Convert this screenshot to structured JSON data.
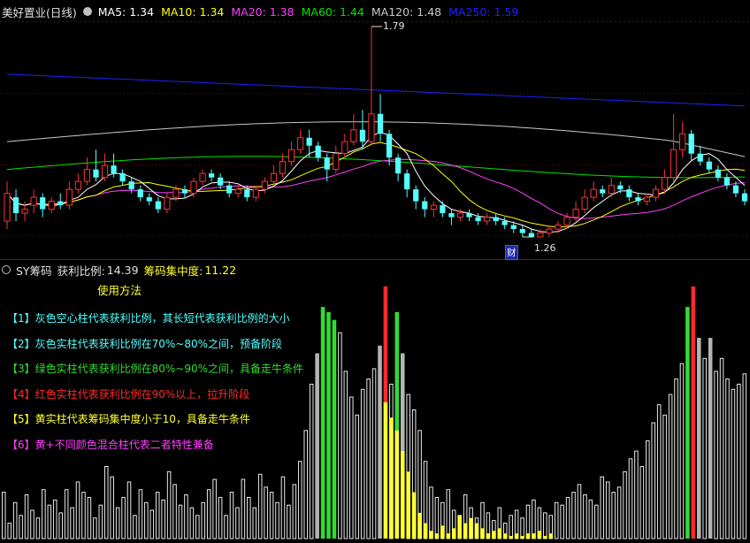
{
  "colors": {
    "up": "#ff3232",
    "down": "#54ffff",
    "ma5": "#ffffff",
    "ma10": "#ffff00",
    "ma20": "#ff40ff",
    "ma60": "#00e600",
    "ma120": "#c8c8c8",
    "ma250": "#2020ff",
    "hollow_gray": "#e8e8e8",
    "solid_gray": "#b4b4b4",
    "green": "#32dc32",
    "red": "#ff2a2a",
    "yellow": "#ffff32",
    "grid": "#7a0000"
  },
  "top_panel": {
    "title": "美好置业(日线)",
    "ma": [
      {
        "label": "MA5:",
        "value": "1.34",
        "color": "#ffffff"
      },
      {
        "label": "MA10:",
        "value": "1.34",
        "color": "#ffff00"
      },
      {
        "label": "MA20:",
        "value": "1.38",
        "color": "#ff40ff"
      },
      {
        "label": "MA60:",
        "value": "1.44",
        "color": "#00e600"
      },
      {
        "label": "MA120:",
        "value": "1.48",
        "color": "#c8c8c8"
      },
      {
        "label": "MA250:",
        "value": "1.59",
        "color": "#2020ff"
      }
    ],
    "high_label": "1.79",
    "low_label": "1.26",
    "cai_badge": "财"
  },
  "bottom_panel": {
    "indicator_name": "SY筹码",
    "profit_label": "获利比例:",
    "profit_value": "14.39",
    "conc_label": "筹码集中度:",
    "conc_value": "11.22",
    "usage_title": "使用方法",
    "legend": [
      {
        "text": "【1】灰色空心柱代表获利比例，其长短代表获利比例的大小",
        "color": "#54ffff"
      },
      {
        "text": "【2】灰色实柱代表获利比例在70%~80%之间，预备阶段",
        "color": "#54ffff"
      },
      {
        "text": "【3】绿色实柱代表获利比例在80%~90%之间，具备走牛条件",
        "color": "#32dc32"
      },
      {
        "text": "【4】红色实柱代表获利比例在90%以上，拉升阶段",
        "color": "#ff2a2a"
      },
      {
        "text": "【5】黄实柱代表筹码集中度小于10，具备走牛条件",
        "color": "#ffff32"
      },
      {
        "text": "【6】黄+不同颜色混合柱代表二者特性兼备",
        "color": "#ff40ff"
      }
    ]
  },
  "chart_data": [
    {
      "type": "candlestick",
      "title": "美好置业(日线)",
      "y_high": 1.79,
      "y_low": 1.26,
      "candles": [
        [
          1.3,
          1.37,
          1.4,
          1.28
        ],
        [
          1.36,
          1.32,
          1.38,
          1.3
        ],
        [
          1.32,
          1.33,
          1.35,
          1.3
        ],
        [
          1.34,
          1.36,
          1.38,
          1.32
        ],
        [
          1.36,
          1.33,
          1.37,
          1.31
        ],
        [
          1.33,
          1.35,
          1.36,
          1.32
        ],
        [
          1.35,
          1.34,
          1.37,
          1.33
        ],
        [
          1.34,
          1.38,
          1.4,
          1.33
        ],
        [
          1.38,
          1.4,
          1.42,
          1.37
        ],
        [
          1.4,
          1.43,
          1.46,
          1.39
        ],
        [
          1.43,
          1.41,
          1.48,
          1.4
        ],
        [
          1.41,
          1.44,
          1.47,
          1.4
        ],
        [
          1.44,
          1.42,
          1.47,
          1.41
        ],
        [
          1.42,
          1.4,
          1.43,
          1.39
        ],
        [
          1.4,
          1.38,
          1.41,
          1.37
        ],
        [
          1.38,
          1.36,
          1.39,
          1.35
        ],
        [
          1.36,
          1.35,
          1.37,
          1.34
        ],
        [
          1.35,
          1.33,
          1.36,
          1.32
        ],
        [
          1.33,
          1.36,
          1.37,
          1.32
        ],
        [
          1.36,
          1.38,
          1.39,
          1.35
        ],
        [
          1.38,
          1.37,
          1.39,
          1.36
        ],
        [
          1.37,
          1.4,
          1.41,
          1.36
        ],
        [
          1.4,
          1.42,
          1.43,
          1.39
        ],
        [
          1.42,
          1.41,
          1.43,
          1.4
        ],
        [
          1.41,
          1.39,
          1.42,
          1.38
        ],
        [
          1.39,
          1.37,
          1.4,
          1.36
        ],
        [
          1.37,
          1.38,
          1.39,
          1.36
        ],
        [
          1.38,
          1.36,
          1.39,
          1.35
        ],
        [
          1.36,
          1.38,
          1.39,
          1.35
        ],
        [
          1.38,
          1.4,
          1.41,
          1.37
        ],
        [
          1.4,
          1.42,
          1.44,
          1.39
        ],
        [
          1.42,
          1.45,
          1.47,
          1.41
        ],
        [
          1.45,
          1.48,
          1.5,
          1.44
        ],
        [
          1.48,
          1.51,
          1.53,
          1.47
        ],
        [
          1.51,
          1.49,
          1.53,
          1.46
        ],
        [
          1.49,
          1.46,
          1.5,
          1.45
        ],
        [
          1.46,
          1.43,
          1.47,
          1.4
        ],
        [
          1.43,
          1.47,
          1.49,
          1.42
        ],
        [
          1.47,
          1.5,
          1.52,
          1.46
        ],
        [
          1.5,
          1.53,
          1.57,
          1.49
        ],
        [
          1.53,
          1.5,
          1.58,
          1.48
        ],
        [
          1.5,
          1.57,
          1.79,
          1.49
        ],
        [
          1.57,
          1.52,
          1.62,
          1.5
        ],
        [
          1.52,
          1.46,
          1.53,
          1.44
        ],
        [
          1.46,
          1.42,
          1.47,
          1.4
        ],
        [
          1.42,
          1.38,
          1.43,
          1.36
        ],
        [
          1.38,
          1.35,
          1.39,
          1.33
        ],
        [
          1.35,
          1.33,
          1.36,
          1.31
        ],
        [
          1.33,
          1.34,
          1.35,
          1.31
        ],
        [
          1.34,
          1.32,
          1.35,
          1.31
        ],
        [
          1.32,
          1.31,
          1.33,
          1.29
        ],
        [
          1.31,
          1.32,
          1.33,
          1.3
        ],
        [
          1.32,
          1.31,
          1.33,
          1.3
        ],
        [
          1.31,
          1.3,
          1.32,
          1.29
        ],
        [
          1.3,
          1.31,
          1.32,
          1.29
        ],
        [
          1.31,
          1.3,
          1.32,
          1.29
        ],
        [
          1.3,
          1.29,
          1.31,
          1.28
        ],
        [
          1.29,
          1.28,
          1.3,
          1.27
        ],
        [
          1.28,
          1.27,
          1.29,
          1.26
        ],
        [
          1.27,
          1.26,
          1.28,
          1.26
        ],
        [
          1.26,
          1.27,
          1.28,
          1.26
        ],
        [
          1.27,
          1.28,
          1.29,
          1.26
        ],
        [
          1.28,
          1.29,
          1.3,
          1.27
        ],
        [
          1.29,
          1.31,
          1.32,
          1.28
        ],
        [
          1.31,
          1.33,
          1.35,
          1.3
        ],
        [
          1.33,
          1.36,
          1.38,
          1.32
        ],
        [
          1.36,
          1.38,
          1.4,
          1.35
        ],
        [
          1.38,
          1.37,
          1.39,
          1.36
        ],
        [
          1.37,
          1.39,
          1.41,
          1.36
        ],
        [
          1.39,
          1.38,
          1.4,
          1.37
        ],
        [
          1.38,
          1.36,
          1.39,
          1.35
        ],
        [
          1.36,
          1.35,
          1.37,
          1.34
        ],
        [
          1.35,
          1.36,
          1.37,
          1.34
        ],
        [
          1.36,
          1.38,
          1.39,
          1.35
        ],
        [
          1.38,
          1.41,
          1.43,
          1.37
        ],
        [
          1.41,
          1.48,
          1.57,
          1.4
        ],
        [
          1.48,
          1.52,
          1.55,
          1.46
        ],
        [
          1.52,
          1.47,
          1.53,
          1.45
        ],
        [
          1.47,
          1.45,
          1.49,
          1.44
        ],
        [
          1.45,
          1.43,
          1.46,
          1.42
        ],
        [
          1.43,
          1.41,
          1.44,
          1.4
        ],
        [
          1.41,
          1.39,
          1.42,
          1.38
        ],
        [
          1.39,
          1.37,
          1.4,
          1.36
        ],
        [
          1.37,
          1.35,
          1.38,
          1.34
        ]
      ],
      "ma": {
        "MA5": 1.34,
        "MA10": 1.34,
        "MA20": 1.38,
        "MA60": 1.44,
        "MA120": 1.48,
        "MA250": 1.59
      }
    },
    {
      "type": "bar",
      "title": "SY筹码",
      "value_labels": {
        "获利比例": 14.39,
        "筹码集中度": 11.22
      },
      "ylim": [
        0,
        100
      ],
      "bars": [
        {
          "v": 18,
          "c": "h",
          "y": 0
        },
        {
          "v": 6,
          "c": "h",
          "y": 0
        },
        {
          "v": 14,
          "c": "h",
          "y": 0
        },
        {
          "v": 9,
          "c": "h",
          "y": 0
        },
        {
          "v": 17,
          "c": "h",
          "y": 0
        },
        {
          "v": 11,
          "c": "h",
          "y": 0
        },
        {
          "v": 8,
          "c": "h",
          "y": 0
        },
        {
          "v": 19,
          "c": "h",
          "y": 0
        },
        {
          "v": 13,
          "c": "h",
          "y": 0
        },
        {
          "v": 15,
          "c": "h",
          "y": 0
        },
        {
          "v": 10,
          "c": "h",
          "y": 0
        },
        {
          "v": 19,
          "c": "h",
          "y": 0
        },
        {
          "v": 12,
          "c": "h",
          "y": 0
        },
        {
          "v": 22,
          "c": "h",
          "y": 0
        },
        {
          "v": 18,
          "c": "h",
          "y": 0
        },
        {
          "v": 16,
          "c": "h",
          "y": 0
        },
        {
          "v": 8,
          "c": "h",
          "y": 0
        },
        {
          "v": 13,
          "c": "h",
          "y": 0
        },
        {
          "v": 28,
          "c": "h",
          "y": 0
        },
        {
          "v": 24,
          "c": "h",
          "y": 0
        },
        {
          "v": 12,
          "c": "h",
          "y": 0
        },
        {
          "v": 16,
          "c": "h",
          "y": 0
        },
        {
          "v": 22,
          "c": "h",
          "y": 0
        },
        {
          "v": 9,
          "c": "h",
          "y": 0
        },
        {
          "v": 19,
          "c": "h",
          "y": 0
        },
        {
          "v": 14,
          "c": "h",
          "y": 0
        },
        {
          "v": 11,
          "c": "h",
          "y": 0
        },
        {
          "v": 18,
          "c": "h",
          "y": 0
        },
        {
          "v": 15,
          "c": "h",
          "y": 0
        },
        {
          "v": 26,
          "c": "h",
          "y": 0
        },
        {
          "v": 21,
          "c": "h",
          "y": 0
        },
        {
          "v": 13,
          "c": "h",
          "y": 0
        },
        {
          "v": 17,
          "c": "h",
          "y": 0
        },
        {
          "v": 12,
          "c": "h",
          "y": 0
        },
        {
          "v": 9,
          "c": "h",
          "y": 0
        },
        {
          "v": 14,
          "c": "h",
          "y": 0
        },
        {
          "v": 19,
          "c": "h",
          "y": 0
        },
        {
          "v": 23,
          "c": "h",
          "y": 0
        },
        {
          "v": 16,
          "c": "h",
          "y": 0
        },
        {
          "v": 9,
          "c": "h",
          "y": 0
        },
        {
          "v": 18,
          "c": "h",
          "y": 0
        },
        {
          "v": 12,
          "c": "h",
          "y": 0
        },
        {
          "v": 23,
          "c": "h",
          "y": 0
        },
        {
          "v": 16,
          "c": "h",
          "y": 0
        },
        {
          "v": 12,
          "c": "h",
          "y": 0
        },
        {
          "v": 25,
          "c": "h",
          "y": 0
        },
        {
          "v": 20,
          "c": "h",
          "y": 0
        },
        {
          "v": 18,
          "c": "h",
          "y": 0
        },
        {
          "v": 14,
          "c": "h",
          "y": 0
        },
        {
          "v": 24,
          "c": "h",
          "y": 0
        },
        {
          "v": 13,
          "c": "h",
          "y": 0
        },
        {
          "v": 21,
          "c": "h",
          "y": 0
        },
        {
          "v": 30,
          "c": "h",
          "y": 0
        },
        {
          "v": 42,
          "c": "h",
          "y": 0
        },
        {
          "v": 60,
          "c": "h",
          "y": 0
        },
        {
          "v": 72,
          "c": "s",
          "y": 0
        },
        {
          "v": 90,
          "c": "g",
          "y": 0
        },
        {
          "v": 88,
          "c": "g",
          "y": 0
        },
        {
          "v": 85,
          "c": "g",
          "y": 0
        },
        {
          "v": 80,
          "c": "h",
          "y": 0
        },
        {
          "v": 65,
          "c": "h",
          "y": 0
        },
        {
          "v": 55,
          "c": "h",
          "y": 0
        },
        {
          "v": 48,
          "c": "h",
          "y": 0
        },
        {
          "v": 58,
          "c": "h",
          "y": 0
        },
        {
          "v": 62,
          "c": "h",
          "y": 0
        },
        {
          "v": 66,
          "c": "h",
          "y": 0
        },
        {
          "v": 75,
          "c": "s",
          "y": 0
        },
        {
          "v": 98,
          "c": "r",
          "y": 53
        },
        {
          "v": 60,
          "c": "h",
          "y": 47
        },
        {
          "v": 88,
          "c": "g",
          "y": 42
        },
        {
          "v": 72,
          "c": "s",
          "y": 34
        },
        {
          "v": 56,
          "c": "h",
          "y": 26
        },
        {
          "v": 50,
          "c": "h",
          "y": 18
        },
        {
          "v": 42,
          "c": "h",
          "y": 10
        },
        {
          "v": 30,
          "c": "h",
          "y": 6
        },
        {
          "v": 20,
          "c": "h",
          "y": 3
        },
        {
          "v": 16,
          "c": "h",
          "y": 2
        },
        {
          "v": 14,
          "c": "h",
          "y": 5
        },
        {
          "v": 19,
          "c": "h",
          "y": 2
        },
        {
          "v": 11,
          "c": "h",
          "y": 4
        },
        {
          "v": 9,
          "c": "h",
          "y": 9
        },
        {
          "v": 17,
          "c": "h",
          "y": 6
        },
        {
          "v": 12,
          "c": "h",
          "y": 8
        },
        {
          "v": 8,
          "c": "h",
          "y": 6
        },
        {
          "v": 14,
          "c": "h",
          "y": 4
        },
        {
          "v": 10,
          "c": "h",
          "y": 2
        },
        {
          "v": 7,
          "c": "h",
          "y": 3
        },
        {
          "v": 12,
          "c": "h",
          "y": 4
        },
        {
          "v": 6,
          "c": "h",
          "y": 2
        },
        {
          "v": 9,
          "c": "h",
          "y": 1
        },
        {
          "v": 11,
          "c": "h",
          "y": 2
        },
        {
          "v": 8,
          "c": "h",
          "y": 1
        },
        {
          "v": 13,
          "c": "h",
          "y": 2
        },
        {
          "v": 15,
          "c": "h",
          "y": 2
        },
        {
          "v": 12,
          "c": "h",
          "y": 3
        },
        {
          "v": 10,
          "c": "h",
          "y": 1
        },
        {
          "v": 9,
          "c": "h",
          "y": 2
        },
        {
          "v": 14,
          "c": "h",
          "y": 0
        },
        {
          "v": 13,
          "c": "h",
          "y": 0
        },
        {
          "v": 16,
          "c": "h",
          "y": 0
        },
        {
          "v": 18,
          "c": "h",
          "y": 0
        },
        {
          "v": 21,
          "c": "h",
          "y": 0
        },
        {
          "v": 17,
          "c": "h",
          "y": 0
        },
        {
          "v": 15,
          "c": "h",
          "y": 0
        },
        {
          "v": 13,
          "c": "h",
          "y": 0
        },
        {
          "v": 24,
          "c": "h",
          "y": 0
        },
        {
          "v": 22,
          "c": "h",
          "y": 0
        },
        {
          "v": 18,
          "c": "h",
          "y": 0
        },
        {
          "v": 20,
          "c": "h",
          "y": 0
        },
        {
          "v": 26,
          "c": "h",
          "y": 0
        },
        {
          "v": 31,
          "c": "h",
          "y": 0
        },
        {
          "v": 34,
          "c": "h",
          "y": 0
        },
        {
          "v": 28,
          "c": "h",
          "y": 0
        },
        {
          "v": 38,
          "c": "h",
          "y": 0
        },
        {
          "v": 45,
          "c": "h",
          "y": 0
        },
        {
          "v": 52,
          "c": "h",
          "y": 0
        },
        {
          "v": 48,
          "c": "h",
          "y": 0
        },
        {
          "v": 56,
          "c": "h",
          "y": 0
        },
        {
          "v": 62,
          "c": "h",
          "y": 0
        },
        {
          "v": 68,
          "c": "h",
          "y": 0
        },
        {
          "v": 90,
          "c": "g",
          "y": 0
        },
        {
          "v": 98,
          "c": "r",
          "y": 0
        },
        {
          "v": 78,
          "c": "s",
          "y": 0
        },
        {
          "v": 70,
          "c": "h",
          "y": 0
        },
        {
          "v": 78,
          "c": "s",
          "y": 0
        },
        {
          "v": 65,
          "c": "h",
          "y": 0
        },
        {
          "v": 70,
          "c": "h",
          "y": 0
        },
        {
          "v": 62,
          "c": "h",
          "y": 0
        },
        {
          "v": 58,
          "c": "h",
          "y": 0
        },
        {
          "v": 60,
          "c": "h",
          "y": 0
        },
        {
          "v": 64,
          "c": "h",
          "y": 0
        }
      ]
    }
  ]
}
